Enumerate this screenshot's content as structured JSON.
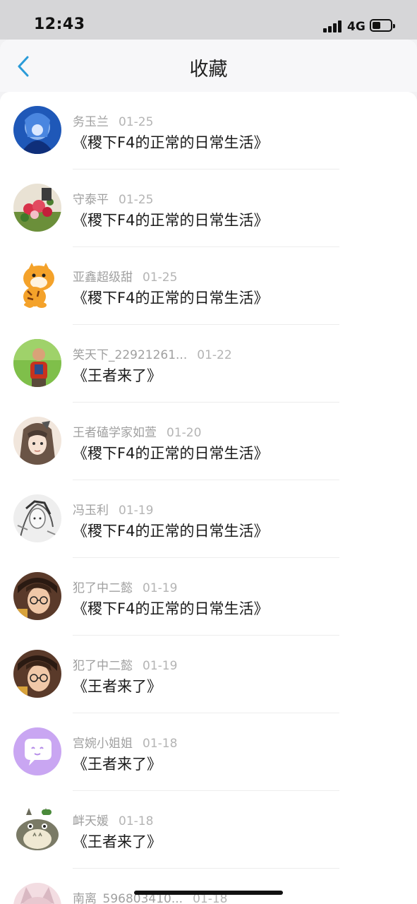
{
  "status_bar": {
    "time": "12:43",
    "network": "4G"
  },
  "nav": {
    "title": "收藏",
    "back_icon": "chevron-left-icon",
    "accent": "#2a9bd8"
  },
  "items": [
    {
      "name": "务玉兰",
      "date": "01-25",
      "book": "《稷下F4的正常的日常生活》",
      "avatar_icon": "anime-blue-avatar"
    },
    {
      "name": "守泰平",
      "date": "01-25",
      "book": "《稷下F4的正常的日常生活》",
      "avatar_icon": "flower-bouquet-avatar"
    },
    {
      "name": "亚鑫超级甜",
      "date": "01-25",
      "book": "《稷下F4的正常的日常生活》",
      "avatar_icon": "tiger-cartoon-avatar"
    },
    {
      "name": "笑天下_22921261...",
      "date": "01-22",
      "book": "《王者来了》",
      "avatar_icon": "child-photo-avatar"
    },
    {
      "name": "王者磕学家如萱",
      "date": "01-20",
      "book": "《稷下F4的正常的日常生活》",
      "avatar_icon": "anime-girl-avatar"
    },
    {
      "name": "冯玉利",
      "date": "01-19",
      "book": "《稷下F4的正常的日常生活》",
      "avatar_icon": "sketch-avatar"
    },
    {
      "name": "犯了中二懿",
      "date": "01-19",
      "book": "《稷下F4的正常的日常生活》",
      "avatar_icon": "glasses-boy-avatar"
    },
    {
      "name": "犯了中二懿",
      "date": "01-19",
      "book": "《王者来了》",
      "avatar_icon": "glasses-boy-avatar"
    },
    {
      "name": "宫婉小姐姐",
      "date": "01-18",
      "book": "《王者来了》",
      "avatar_icon": "purple-chat-avatar"
    },
    {
      "name": "衅天媛",
      "date": "01-18",
      "book": "《王者来了》",
      "avatar_icon": "totoro-avatar"
    },
    {
      "name": "南离_596803410...",
      "date": "01-18",
      "book": "",
      "avatar_icon": "cat-avatar"
    }
  ]
}
